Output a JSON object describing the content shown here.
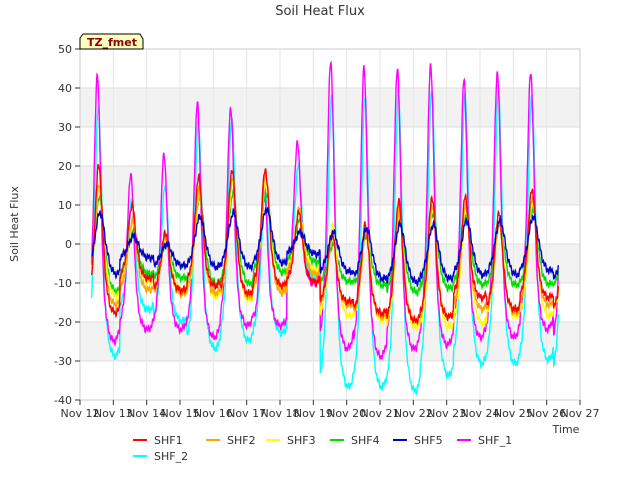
{
  "chart_data": {
    "type": "line",
    "title": "Soil Heat Flux",
    "xlabel": "Time",
    "ylabel": "Soil Heat Flux",
    "ylim": [
      -40,
      50
    ],
    "xlim": [
      0,
      15
    ],
    "yticks": [
      -40,
      -30,
      -20,
      -10,
      0,
      10,
      20,
      30,
      40,
      50
    ],
    "xtick_labels": [
      "Nov 12",
      "Nov 13",
      "Nov 14",
      "Nov 15",
      "Nov 16",
      "Nov 17",
      "Nov 18",
      "Nov 19",
      "Nov 20",
      "Nov 21",
      "Nov 22",
      "Nov 23",
      "Nov 24",
      "Nov 25",
      "Nov 26",
      "Nov 27"
    ],
    "x_units": "days since Nov 12",
    "grid": true,
    "legend_position": "bottom",
    "station_label": "TZ_fmet",
    "start_day": 0.35,
    "end_day": 14.35,
    "series": [
      {
        "name": "SHF1",
        "color": "#ff0000",
        "days": [
          {
            "min": -18,
            "max": 20
          },
          {
            "min": -9,
            "max": 10
          },
          {
            "min": -12,
            "max": 3
          },
          {
            "min": -11,
            "max": 17
          },
          {
            "min": -13,
            "max": 19
          },
          {
            "min": -11,
            "max": 19
          },
          {
            "min": -10,
            "max": 8
          },
          {
            "min": -15,
            "max": 3
          },
          {
            "min": -18,
            "max": 5
          },
          {
            "min": -20,
            "max": 11
          },
          {
            "min": -19,
            "max": 12
          },
          {
            "min": -14,
            "max": 12
          },
          {
            "min": -17,
            "max": 8
          },
          {
            "min": -14,
            "max": 14
          },
          {
            "min": -18,
            "max": 9
          }
        ]
      },
      {
        "name": "SHF2",
        "color": "#ffa500",
        "days": [
          {
            "min": -16,
            "max": 15
          },
          {
            "min": -12,
            "max": 6
          },
          {
            "min": -13,
            "max": 2
          },
          {
            "min": -13,
            "max": 14
          },
          {
            "min": -14,
            "max": 17
          },
          {
            "min": -13,
            "max": 18
          },
          {
            "min": -8,
            "max": 9
          },
          {
            "min": -16,
            "max": 2
          },
          {
            "min": -19,
            "max": 3
          },
          {
            "min": -20,
            "max": 9
          },
          {
            "min": -19,
            "max": 10
          },
          {
            "min": -17,
            "max": 10
          },
          {
            "min": -18,
            "max": 6
          },
          {
            "min": -16,
            "max": 12
          },
          {
            "min": -18,
            "max": 8
          }
        ]
      },
      {
        "name": "SHF3",
        "color": "#ffff00",
        "days": [
          {
            "min": -14,
            "max": 14
          },
          {
            "min": -10,
            "max": 5
          },
          {
            "min": -12,
            "max": 2
          },
          {
            "min": -14,
            "max": 13
          },
          {
            "min": -15,
            "max": 16
          },
          {
            "min": -12,
            "max": 16
          },
          {
            "min": -7,
            "max": 8
          },
          {
            "min": -19,
            "max": 5
          },
          {
            "min": -20,
            "max": 4
          },
          {
            "min": -22,
            "max": 8
          },
          {
            "min": -22,
            "max": 9
          },
          {
            "min": -21,
            "max": 10
          },
          {
            "min": -19,
            "max": 6
          },
          {
            "min": -19,
            "max": 11
          },
          {
            "min": -19,
            "max": 7
          }
        ]
      },
      {
        "name": "SHF4",
        "color": "#00dd00",
        "days": [
          {
            "min": -13,
            "max": 12
          },
          {
            "min": -8,
            "max": 3
          },
          {
            "min": -9,
            "max": 0
          },
          {
            "min": -11,
            "max": 12
          },
          {
            "min": -11,
            "max": 13
          },
          {
            "min": -8,
            "max": 13
          },
          {
            "min": -5,
            "max": 6
          },
          {
            "min": -10,
            "max": 0
          },
          {
            "min": -11,
            "max": 2
          },
          {
            "min": -13,
            "max": 7
          },
          {
            "min": -12,
            "max": 8
          },
          {
            "min": -11,
            "max": 7
          },
          {
            "min": -11,
            "max": 5
          },
          {
            "min": -11,
            "max": 9
          },
          {
            "min": -12,
            "max": 6
          }
        ]
      },
      {
        "name": "SHF5",
        "color": "#0000cc",
        "days": [
          {
            "min": -9,
            "max": 8
          },
          {
            "min": -4,
            "max": 2
          },
          {
            "min": -6,
            "max": 0
          },
          {
            "min": -7,
            "max": 7
          },
          {
            "min": -7,
            "max": 8
          },
          {
            "min": -6,
            "max": 9
          },
          {
            "min": -3,
            "max": 3
          },
          {
            "min": -8,
            "max": 3
          },
          {
            "min": -10,
            "max": 4
          },
          {
            "min": -11,
            "max": 5
          },
          {
            "min": -10,
            "max": 5
          },
          {
            "min": -9,
            "max": 6
          },
          {
            "min": -9,
            "max": 6
          },
          {
            "min": -8,
            "max": 7
          },
          {
            "min": -11,
            "max": 5
          }
        ]
      },
      {
        "name": "SHF_1",
        "color": "#ff00ff",
        "days": [
          {
            "min": -25,
            "max": 43
          },
          {
            "min": -22,
            "max": 18
          },
          {
            "min": -22,
            "max": 23
          },
          {
            "min": -24,
            "max": 36
          },
          {
            "min": -21,
            "max": 35
          },
          {
            "min": -21,
            "max": 16
          },
          {
            "min": -10,
            "max": 26
          },
          {
            "min": -27,
            "max": 47
          },
          {
            "min": -29,
            "max": 45
          },
          {
            "min": -27,
            "max": 45
          },
          {
            "min": -26,
            "max": 46
          },
          {
            "min": -24,
            "max": 42
          },
          {
            "min": -24,
            "max": 44
          },
          {
            "min": -22,
            "max": 44
          },
          {
            "min": -28,
            "max": 44
          }
        ]
      },
      {
        "name": "SHF_2",
        "color": "#00ffff",
        "days": [
          {
            "min": -29,
            "max": 35
          },
          {
            "min": -17,
            "max": 11
          },
          {
            "min": -20,
            "max": 15
          },
          {
            "min": -27,
            "max": 31
          },
          {
            "min": -25,
            "max": 32
          },
          {
            "min": -23,
            "max": 14
          },
          {
            "min": -9,
            "max": 20
          },
          {
            "min": -37,
            "max": 38
          },
          {
            "min": -37,
            "max": 38
          },
          {
            "min": -38,
            "max": 39
          },
          {
            "min": -34,
            "max": 40
          },
          {
            "min": -31,
            "max": 38
          },
          {
            "min": -31,
            "max": 39
          },
          {
            "min": -30,
            "max": 38
          },
          {
            "min": -35,
            "max": 38
          }
        ]
      }
    ]
  }
}
